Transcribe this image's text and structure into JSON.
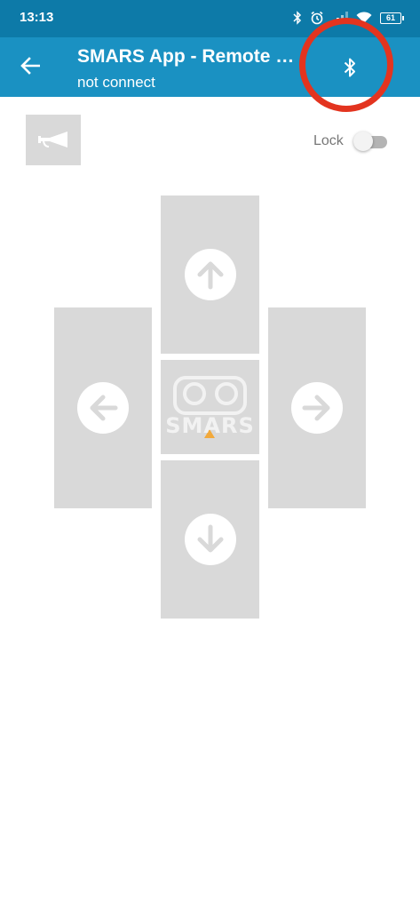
{
  "status_bar": {
    "time": "13:13",
    "battery_level": "61",
    "icons": [
      "bluetooth-icon",
      "alarm-icon",
      "signal-icon",
      "wifi-icon",
      "battery-icon"
    ]
  },
  "app_bar": {
    "title": "SMARS App - Remote Control",
    "subtitle": "not connect",
    "icons": [
      "back-arrow-icon",
      "bluetooth-icon"
    ]
  },
  "controls": {
    "horn_icon": "horn-icon",
    "lock_label": "Lock",
    "lock_on": false
  },
  "dpad": {
    "icons": [
      "arrow-up-icon",
      "arrow-left-icon",
      "arrow-right-icon",
      "arrow-down-icon"
    ],
    "logo_text": "SMARS"
  },
  "colors": {
    "status_bar": "#0d7aa8",
    "app_bar": "#1a91c2",
    "pad": "#d9d9d9",
    "highlight": "#e3341f",
    "logo_accent": "#f2a93b"
  }
}
